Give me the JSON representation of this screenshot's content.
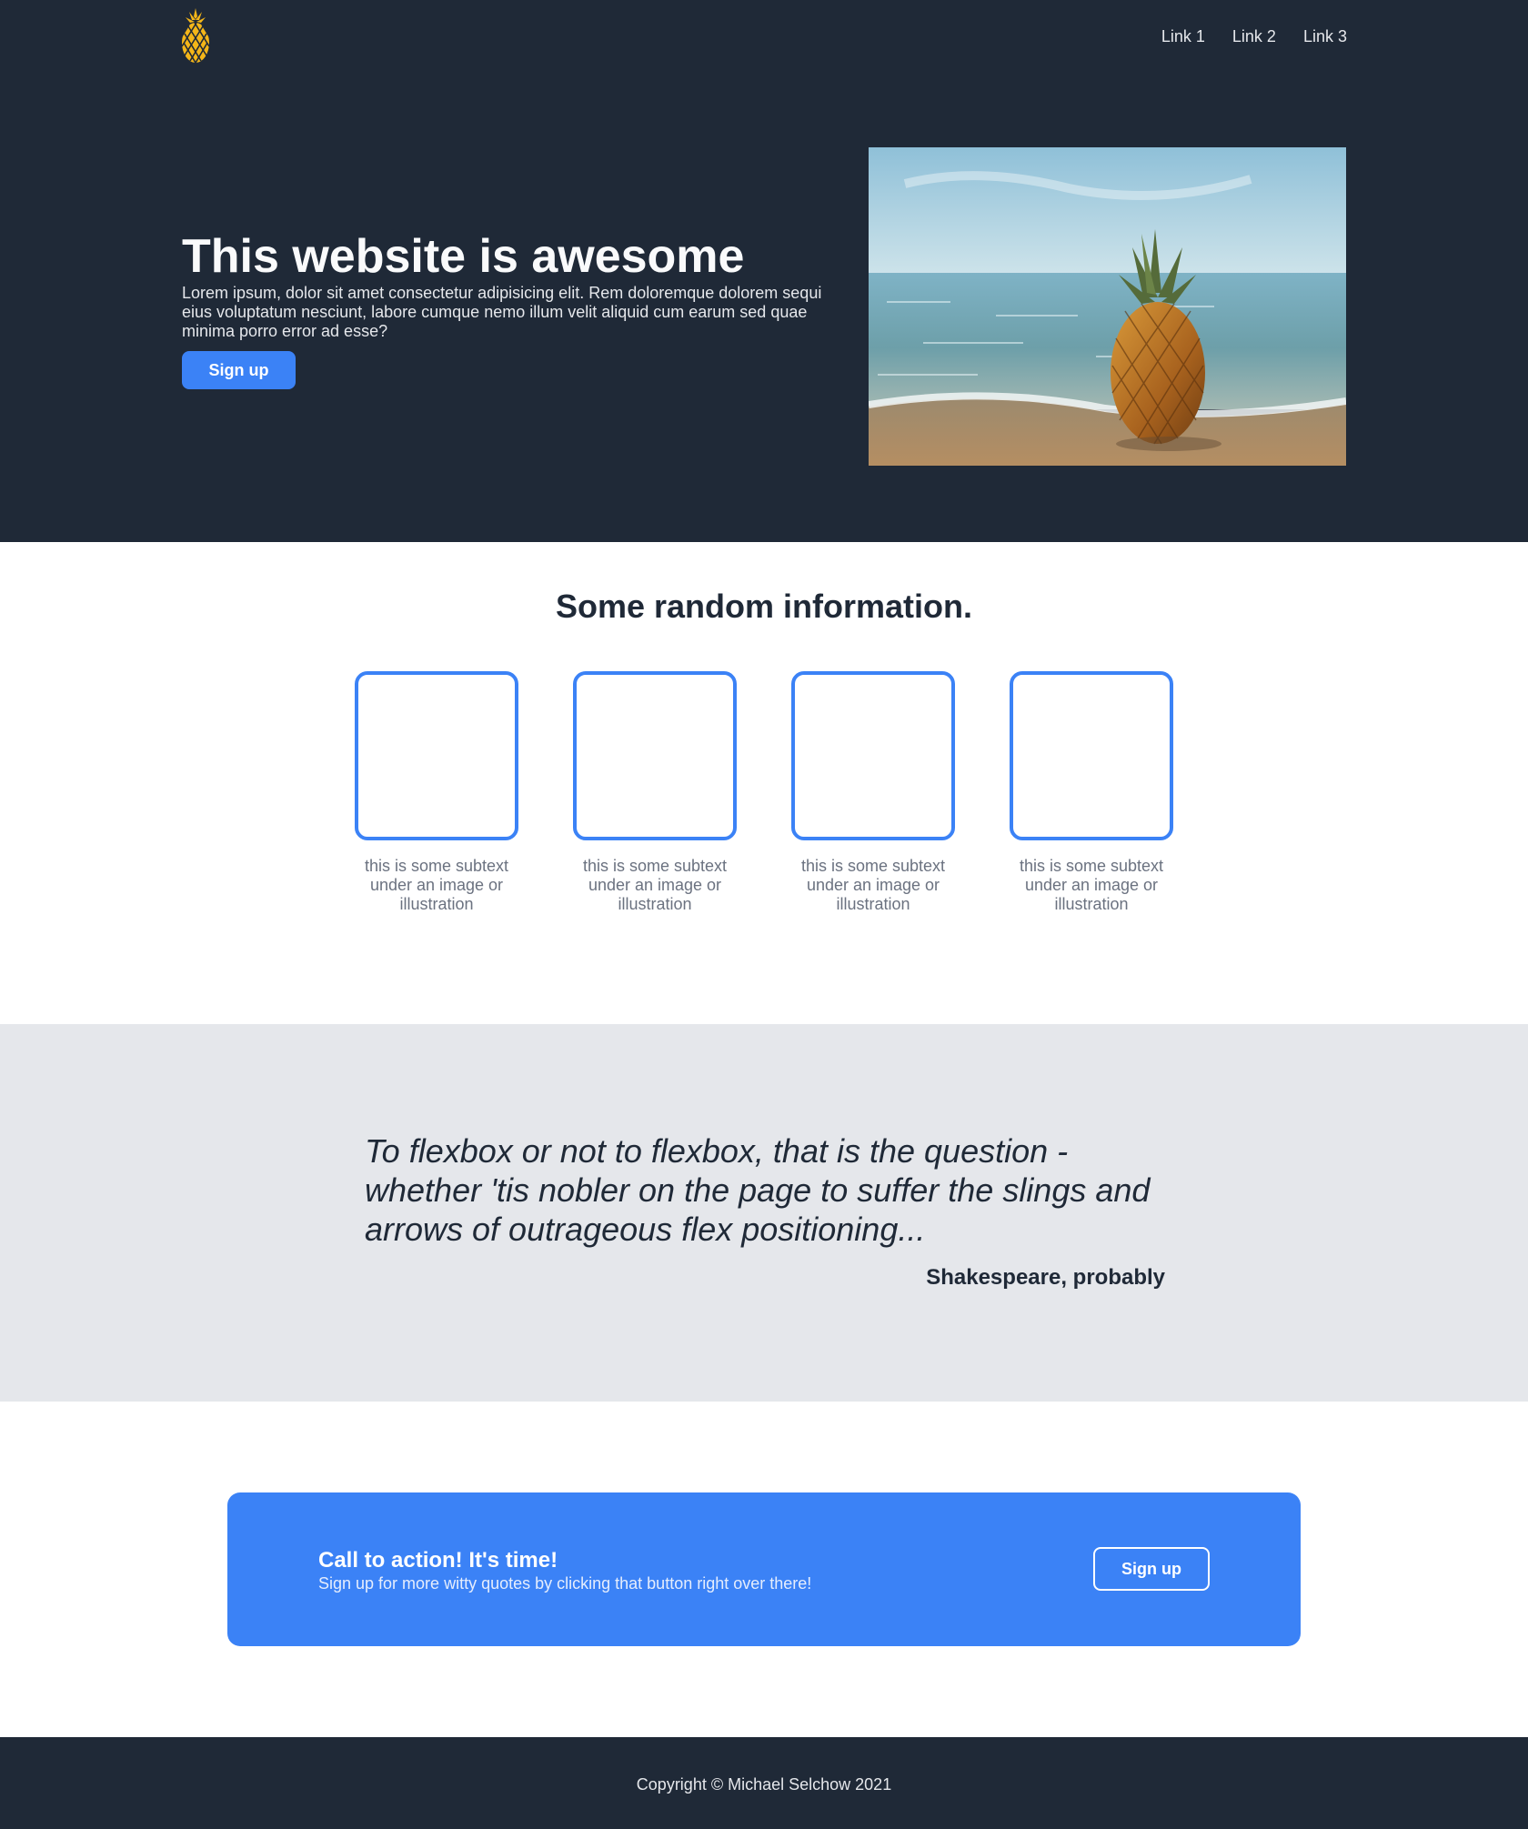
{
  "colors": {
    "dark": "#1f2937",
    "accent": "#3b82f6",
    "light_gray": "#e5e7eb",
    "logo": "#f4b619"
  },
  "header": {
    "logo_icon": "pineapple-icon",
    "links": [
      "Link 1",
      "Link 2",
      "Link 3"
    ]
  },
  "hero": {
    "title": "This website is awesome",
    "body": "Lorem ipsum, dolor sit amet consectetur adipisicing elit. Rem doloremque dolorem sequi eius voluptatum nesciunt, labore cumque nemo illum velit aliquid cum earum sed quae minima porro error ad esse?",
    "button": "Sign up",
    "image": "pineapple-on-beach-photo"
  },
  "info": {
    "title": "Some random information.",
    "cards": [
      "this is some subtext under an image or illustration",
      "this is some subtext under an image or illustration",
      "this is some subtext under an image or illustration",
      "this is some subtext under an image or illustration"
    ]
  },
  "quote": {
    "text": "To flexbox or not to flexbox, that is the question - whether 'tis nobler on the page to suffer the slings and arrows of outrageous flex positioning...",
    "author": "Shakespeare, probably"
  },
  "cta": {
    "title": "Call to action! It's time!",
    "subtitle": "Sign up for more witty quotes by clicking that button right over there!",
    "button": "Sign up"
  },
  "footer": {
    "copyright": "Copyright © Michael Selchow 2021"
  }
}
